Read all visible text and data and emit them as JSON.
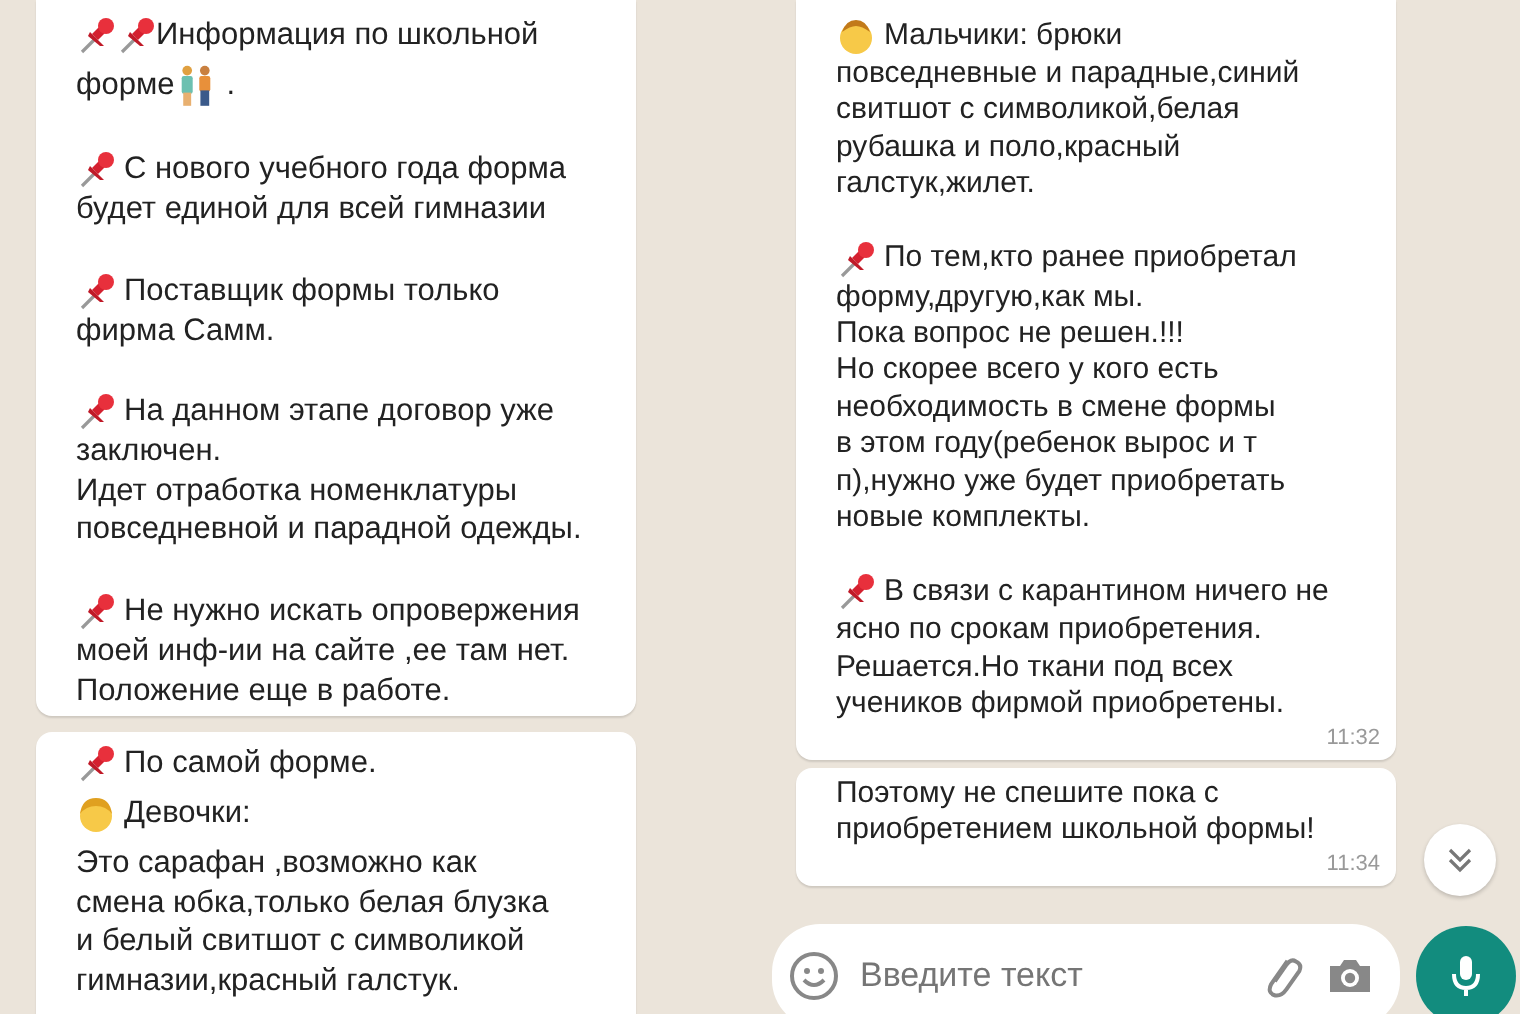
{
  "left_panel": {
    "bubbles": [
      {
        "paragraphs": [
          {
            "kind": "title",
            "lines": [
              "Информация по школьной",
              "форме"
            ],
            "tail": "."
          },
          {
            "kind": "pin",
            "lines": [
              "С нового учебного года форма",
              "будет единой для всей гимназии"
            ]
          },
          {
            "kind": "pin",
            "lines": [
              "Поставщик формы только",
              "фирма Самм."
            ]
          },
          {
            "kind": "pin",
            "lines": [
              "На данном этапе договор уже",
              "заключен.",
              "Идет отработка номенклатуры",
              "повседневной и парадной одежды."
            ]
          },
          {
            "kind": "pin",
            "lines": [
              "Не нужно искать опровержения",
              "моей инф-ии на сайте ,ее там нет.",
              "Положение еще в работе."
            ]
          }
        ]
      },
      {
        "paragraphs": [
          {
            "kind": "pin",
            "lines": [
              "По самой форме."
            ]
          },
          {
            "kind": "girl",
            "lines": [
              "Девочки:"
            ]
          },
          {
            "kind": "plain",
            "lines": [
              "Это сарафан ,возможно как",
              "смена юбка,только белая блузка",
              "и белый свитшот с символикой",
              "гимназии,красный галстук."
            ]
          }
        ]
      }
    ]
  },
  "right_panel": {
    "bubbles": [
      {
        "paragraphs": [
          {
            "kind": "boy",
            "lines": [
              "Мальчики: брюки",
              "повседневные и парадные,синий",
              "свитшот с символикой,белая",
              "рубашка и поло,красный",
              "галстук,жилет."
            ]
          },
          {
            "kind": "pin",
            "lines": [
              "По тем,кто ранее приобретал",
              "форму,другую,как мы.",
              "Пока вопрос не решен.!!!",
              "Но скорее всего у кого есть",
              "необходимость в смене формы",
              "в этом году(ребенок вырос и т",
              "п),нужно уже будет приобретать",
              "новые комплекты."
            ]
          },
          {
            "kind": "pin",
            "lines": [
              "В связи с карантином ничего не",
              "ясно по срокам приобретения.",
              "Решается.Но ткани под всех",
              "учеников фирмой приобретены."
            ]
          }
        ],
        "time": "11:32"
      },
      {
        "paragraphs": [
          {
            "kind": "plain",
            "lines": [
              "Поэтому не спешите пока с",
              "приобретением школьной формы!"
            ]
          }
        ],
        "time": "11:34"
      }
    ]
  },
  "composer": {
    "placeholder": "Введите текст"
  }
}
